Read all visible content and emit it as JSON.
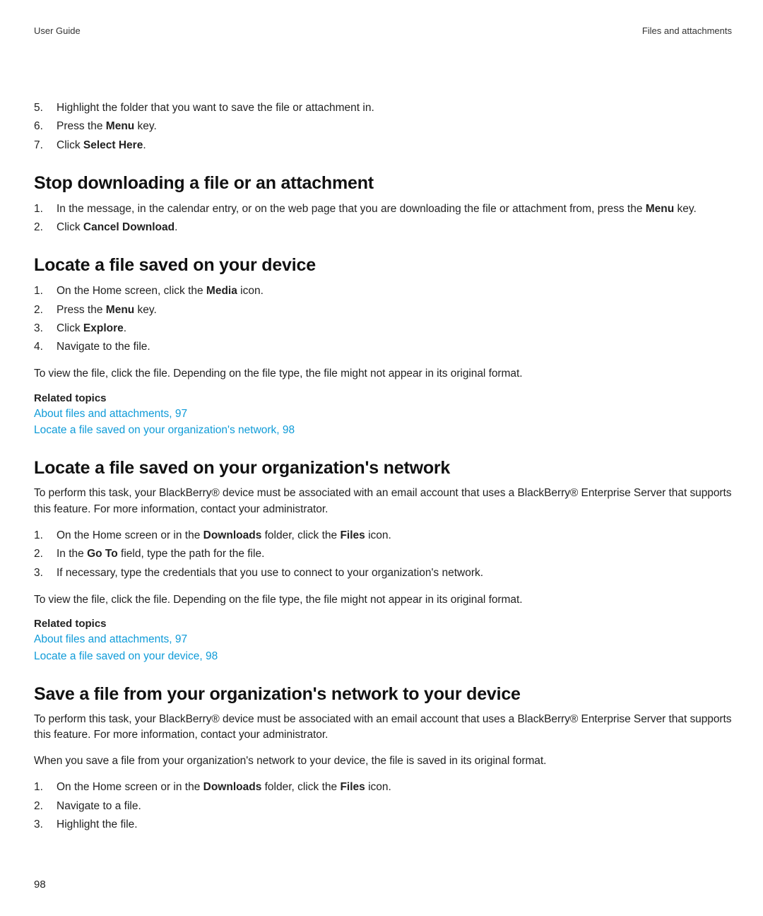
{
  "header": {
    "left": "User Guide",
    "right": "Files and attachments"
  },
  "topList": [
    {
      "n": "5.",
      "html": "Highlight the folder that you want to save the file or attachment in."
    },
    {
      "n": "6.",
      "html": "Press the <b>Menu</b> key."
    },
    {
      "n": "7.",
      "html": "Click <b>Select Here</b>."
    }
  ],
  "sec1": {
    "title": "Stop downloading a file or an attachment",
    "items": [
      {
        "n": "1.",
        "html": "In the message, in the calendar entry, or on the web page that you are downloading the file or attachment from, press the <b>Menu</b> key."
      },
      {
        "n": "2.",
        "html": "Click <b>Cancel Download</b>."
      }
    ]
  },
  "sec2": {
    "title": "Locate a file saved on your device",
    "items": [
      {
        "n": "1.",
        "html": "On the Home screen, click the <b>Media</b> icon."
      },
      {
        "n": "2.",
        "html": "Press the <b>Menu</b> key."
      },
      {
        "n": "3.",
        "html": "Click <b>Explore</b>."
      },
      {
        "n": "4.",
        "html": "Navigate to the file."
      }
    ],
    "para": "To view the file, click the file. Depending on the file type, the file might not appear in its original format.",
    "relatedLabel": "Related topics",
    "links": [
      "About files and attachments, 97",
      "Locate a file saved on your organization's network, 98"
    ]
  },
  "sec3": {
    "title": "Locate a file saved on your organization's network",
    "intro": "To perform this task, your BlackBerry® device must be associated with an email account that uses a BlackBerry® Enterprise Server that supports this feature. For more information, contact your administrator.",
    "items": [
      {
        "n": "1.",
        "html": "On the Home screen or in the <b>Downloads</b> folder, click the <b>Files</b> icon."
      },
      {
        "n": "2.",
        "html": "In the <b>Go To</b> field, type the path for the file."
      },
      {
        "n": "3.",
        "html": "If necessary, type the credentials that you use to connect to your organization's network."
      }
    ],
    "para": "To view the file, click the file. Depending on the file type, the file might not appear in its original format.",
    "relatedLabel": "Related topics",
    "links": [
      "About files and attachments, 97",
      "Locate a file saved on your device, 98"
    ]
  },
  "sec4": {
    "title": "Save a file from your organization's network to your device",
    "intro": "To perform this task, your BlackBerry® device must be associated with an email account that uses a BlackBerry® Enterprise Server that supports this feature. For more information, contact your administrator.",
    "para2": "When you save a file from your organization's network to your device, the file is saved in its original format.",
    "items": [
      {
        "n": "1.",
        "html": "On the Home screen or in the <b>Downloads</b> folder, click the <b>Files</b> icon."
      },
      {
        "n": "2.",
        "html": "Navigate to a file."
      },
      {
        "n": "3.",
        "html": "Highlight the file."
      }
    ]
  },
  "pageNumber": "98"
}
